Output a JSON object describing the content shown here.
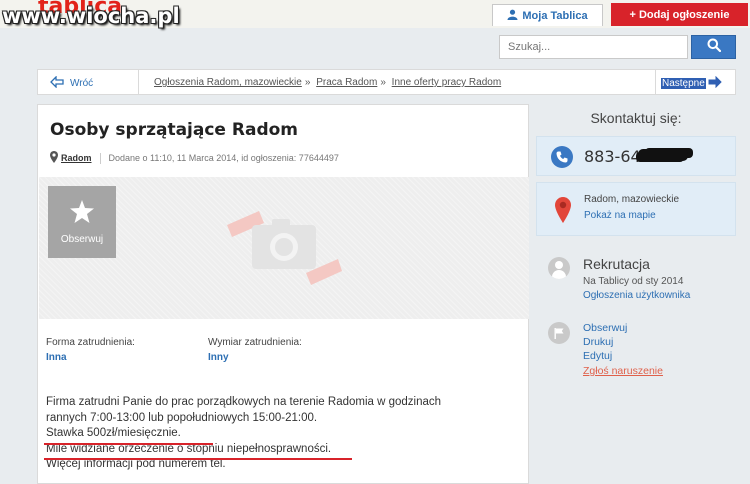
{
  "watermark": {
    "site": "www.wiocha.pl",
    "logo_text": "tablica"
  },
  "header": {
    "my_account_label": "Moja Tablica",
    "add_ad_label": "Dodaj ogłoszenie",
    "add_ad_plus": "+"
  },
  "search": {
    "placeholder": "Szukaj..."
  },
  "breadcrumb": {
    "back_label": "Wróć",
    "items": [
      "Ogłoszenia Radom, mazowieckie",
      "Praca Radom",
      "Inne oferty pracy Radom"
    ],
    "next_label": "Następne"
  },
  "ad": {
    "title": "Osoby sprzątające Radom",
    "location": "Radom",
    "posted": "Dodane o 11:10, 11 Marca 2014, id ogłoszenia: 77644497",
    "observe_label": "Obserwuj",
    "details": [
      {
        "label": "Forma zatrudnienia:",
        "value": "Inna"
      },
      {
        "label": "Wymiar zatrudnienia:",
        "value": "Inny"
      }
    ],
    "description": [
      "Firma zatrudni Panie do prac porządkowych na terenie Radomia w godzinach",
      "rannych 7:00-13:00 lub popołudniowych 15:00-21:00.",
      "Stawka 500zł/miesięcznie.",
      "Mile widziane orzeczenie o stopniu niepełnosprawności.",
      "Więcej informacji pod numerem tel."
    ]
  },
  "contact": {
    "heading": "Skontaktuj się:",
    "phone": "883-648-",
    "location": "Radom, mazowieckie",
    "map_link": "Pokaż na mapie"
  },
  "user": {
    "name": "Rekrutacja",
    "since": "Na Tablicy od sty 2014",
    "ads_link": "Ogłoszenia użytkownika"
  },
  "actions": [
    "Obserwuj",
    "Drukuj",
    "Edytuj",
    "Zgłoś naruszenie"
  ],
  "colors": {
    "brand_blue": "#3a78c3",
    "add_red": "#d8232a",
    "link_blue": "#2d6fb3",
    "underline_red": "#d8232a"
  }
}
